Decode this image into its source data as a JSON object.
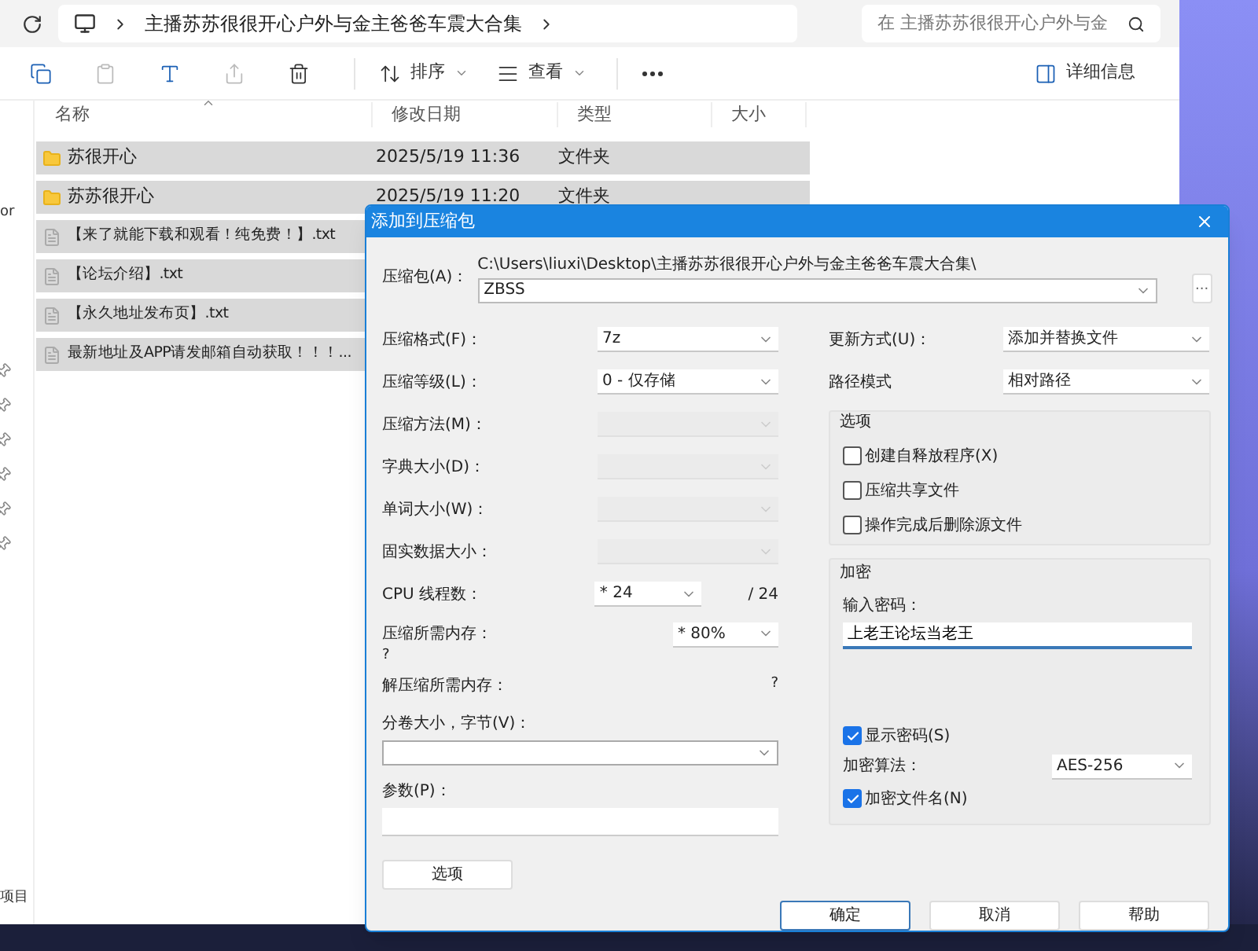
{
  "explorer": {
    "address": {
      "segments": [
        "主播苏苏很很开心户外与金主爸爸车震大合集"
      ]
    },
    "search": {
      "placeholder": "在 主播苏苏很很开心户外与金"
    },
    "toolbar": [
      {
        "kind": "copy",
        "disabled": false
      },
      {
        "kind": "paste",
        "disabled": true
      },
      {
        "kind": "rename",
        "disabled": false
      },
      {
        "kind": "share",
        "disabled": true
      },
      {
        "kind": "delete",
        "disabled": false
      },
      {
        "kind": "sort",
        "label": "排序",
        "disabled": false
      },
      {
        "kind": "view",
        "label": "查看",
        "disabled": false
      },
      {
        "kind": "more",
        "disabled": false
      }
    ],
    "details_button": "详细信息",
    "columns": [
      "名称",
      "修改日期",
      "类型",
      "大小"
    ],
    "rows": [
      {
        "kind": "folder",
        "name": "苏很开心",
        "date": "2025/5/19 11:36",
        "type": "文件夹",
        "selected": true
      },
      {
        "kind": "folder",
        "name": "苏苏很开心",
        "date": "2025/5/19 11:20",
        "type": "文件夹",
        "selected": true
      },
      {
        "kind": "file",
        "name": "【来了就能下载和观看！纯免费！】.txt",
        "selected": true
      },
      {
        "kind": "file",
        "name": "【论坛介绍】.txt",
        "selected": true
      },
      {
        "kind": "file",
        "name": "【永久地址发布页】.txt",
        "selected": true
      },
      {
        "kind": "file",
        "name": "最新地址及APP请发邮箱自动获取！！！...",
        "selected": true
      }
    ],
    "sidebar_text": "or",
    "status_text": "项目"
  },
  "dialog": {
    "title": "添加到压缩包",
    "archive": {
      "label": "压缩包(A)：",
      "path": "C:\\Users\\liuxi\\Desktop\\主播苏苏很很开心户外与金主爸爸车震大合集\\",
      "value": "ZBSS",
      "browse": "..."
    },
    "left_fields": [
      {
        "label": "压缩格式(F)：",
        "value": "7z",
        "disabled": false
      },
      {
        "label": "压缩等级(L)：",
        "value": "0 - 仅存储",
        "disabled": false
      },
      {
        "label": "压缩方法(M)：",
        "disabled": true
      },
      {
        "label": "字典大小(D)：",
        "disabled": true
      },
      {
        "label": "单词大小(W)：",
        "disabled": true
      },
      {
        "label": "固实数据大小：",
        "disabled": true
      },
      {
        "label": "CPU 线程数：",
        "value": "* 24",
        "suffix": "/ 24",
        "disabled": false
      }
    ],
    "memory": {
      "label": "压缩所需内存：",
      "value": "?",
      "combo": "* 80%"
    },
    "unpack_memory": {
      "label": "解压缩所需内存：",
      "value": "?"
    },
    "split": {
      "label": "分卷大小，字节(V)："
    },
    "params": {
      "label": "参数(P)："
    },
    "options_button": "选项",
    "update": {
      "label": "更新方式(U)：",
      "value": "添加并替换文件"
    },
    "path_mode": {
      "label": "路径模式",
      "value": "相对路径"
    },
    "options_group": {
      "title": "选项",
      "items": [
        {
          "label": "创建自释放程序(X)",
          "checked": false
        },
        {
          "label": "压缩共享文件",
          "checked": false
        },
        {
          "label": "操作完成后删除源文件",
          "checked": false
        }
      ]
    },
    "encryption": {
      "title": "加密",
      "password_label": "输入密码：",
      "password": "上老王论坛当老王",
      "show_password": {
        "label": "显示密码(S)",
        "checked": true
      },
      "method_label": "加密算法：",
      "method": "AES-256",
      "encrypt_names": {
        "label": "加密文件名(N)",
        "checked": true
      }
    },
    "buttons": [
      {
        "label": "确定",
        "default": true
      },
      {
        "label": "取消",
        "default": false
      },
      {
        "label": "帮助",
        "default": false
      }
    ]
  }
}
